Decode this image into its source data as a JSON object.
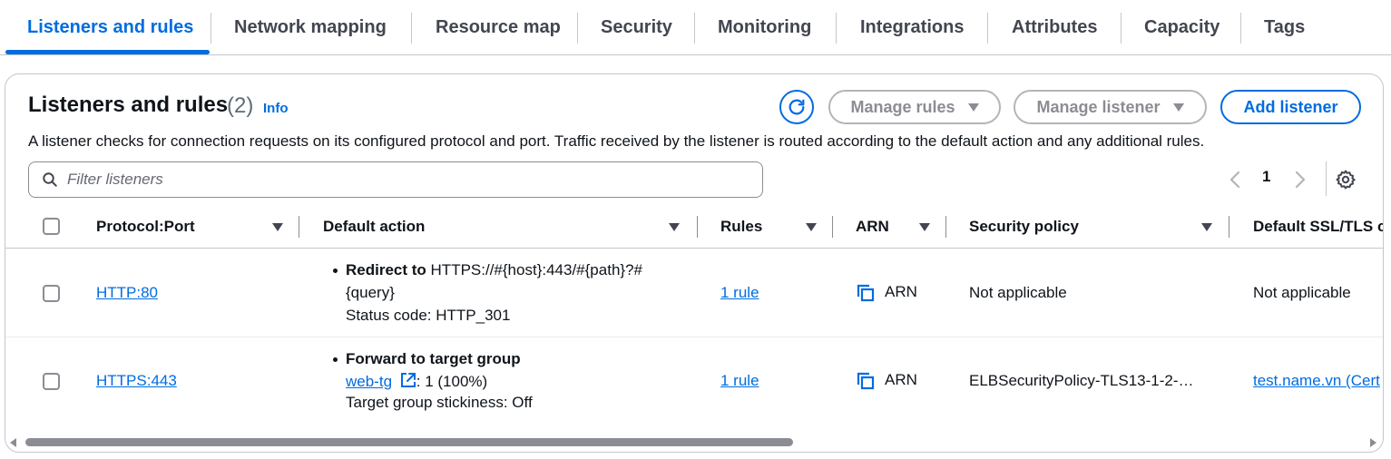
{
  "tabs": [
    {
      "label": "Listeners and rules",
      "active": true
    },
    {
      "label": "Network mapping"
    },
    {
      "label": "Resource map"
    },
    {
      "label": "Security"
    },
    {
      "label": "Monitoring"
    },
    {
      "label": "Integrations"
    },
    {
      "label": "Attributes"
    },
    {
      "label": "Capacity"
    },
    {
      "label": "Tags"
    }
  ],
  "panel": {
    "title": "Listeners and rules",
    "count": "(2)",
    "info": "Info",
    "description": "A listener checks for connection requests on its configured protocol and port. Traffic received by the listener is routed according to the default action and any additional rules.",
    "refresh_icon": "refresh-icon",
    "manage_rules": "Manage rules",
    "manage_listener": "Manage listener",
    "add_listener": "Add listener",
    "search_placeholder": "Filter listeners",
    "page": "1",
    "prev_icon": "chevron-left-icon",
    "next_icon": "chevron-right-icon",
    "settings_icon": "gear-icon"
  },
  "table": {
    "columns": [
      "Protocol:Port",
      "Default action",
      "Rules",
      "ARN",
      "Security policy",
      "Default SSL/TLS c"
    ],
    "rows": [
      {
        "protocol_port": "HTTP:80",
        "action_title": "Redirect to",
        "action_line1": "HTTPS://#{host}:443/#{path}?#",
        "action_line2": "{query}",
        "action_line3": "Status code: HTTP_301",
        "rules": "1 rule",
        "arn": "ARN",
        "security_policy": "Not applicable",
        "ssl_cert": "Not applicable"
      },
      {
        "protocol_port": "HTTPS:443",
        "action_title": "Forward to target group",
        "target_group": "web-tg",
        "target_weight": ": 1 (100%)",
        "action_line3": "Target group stickiness: Off",
        "rules": "1 rule",
        "arn": "ARN",
        "security_policy": "ELBSecurityPolicy-TLS13-1-2-…",
        "ssl_cert": "test.name.vn (Cert"
      }
    ]
  },
  "colors": {
    "accent": "#006ce0",
    "text": "#0f141a",
    "muted": "#8c8c94"
  }
}
